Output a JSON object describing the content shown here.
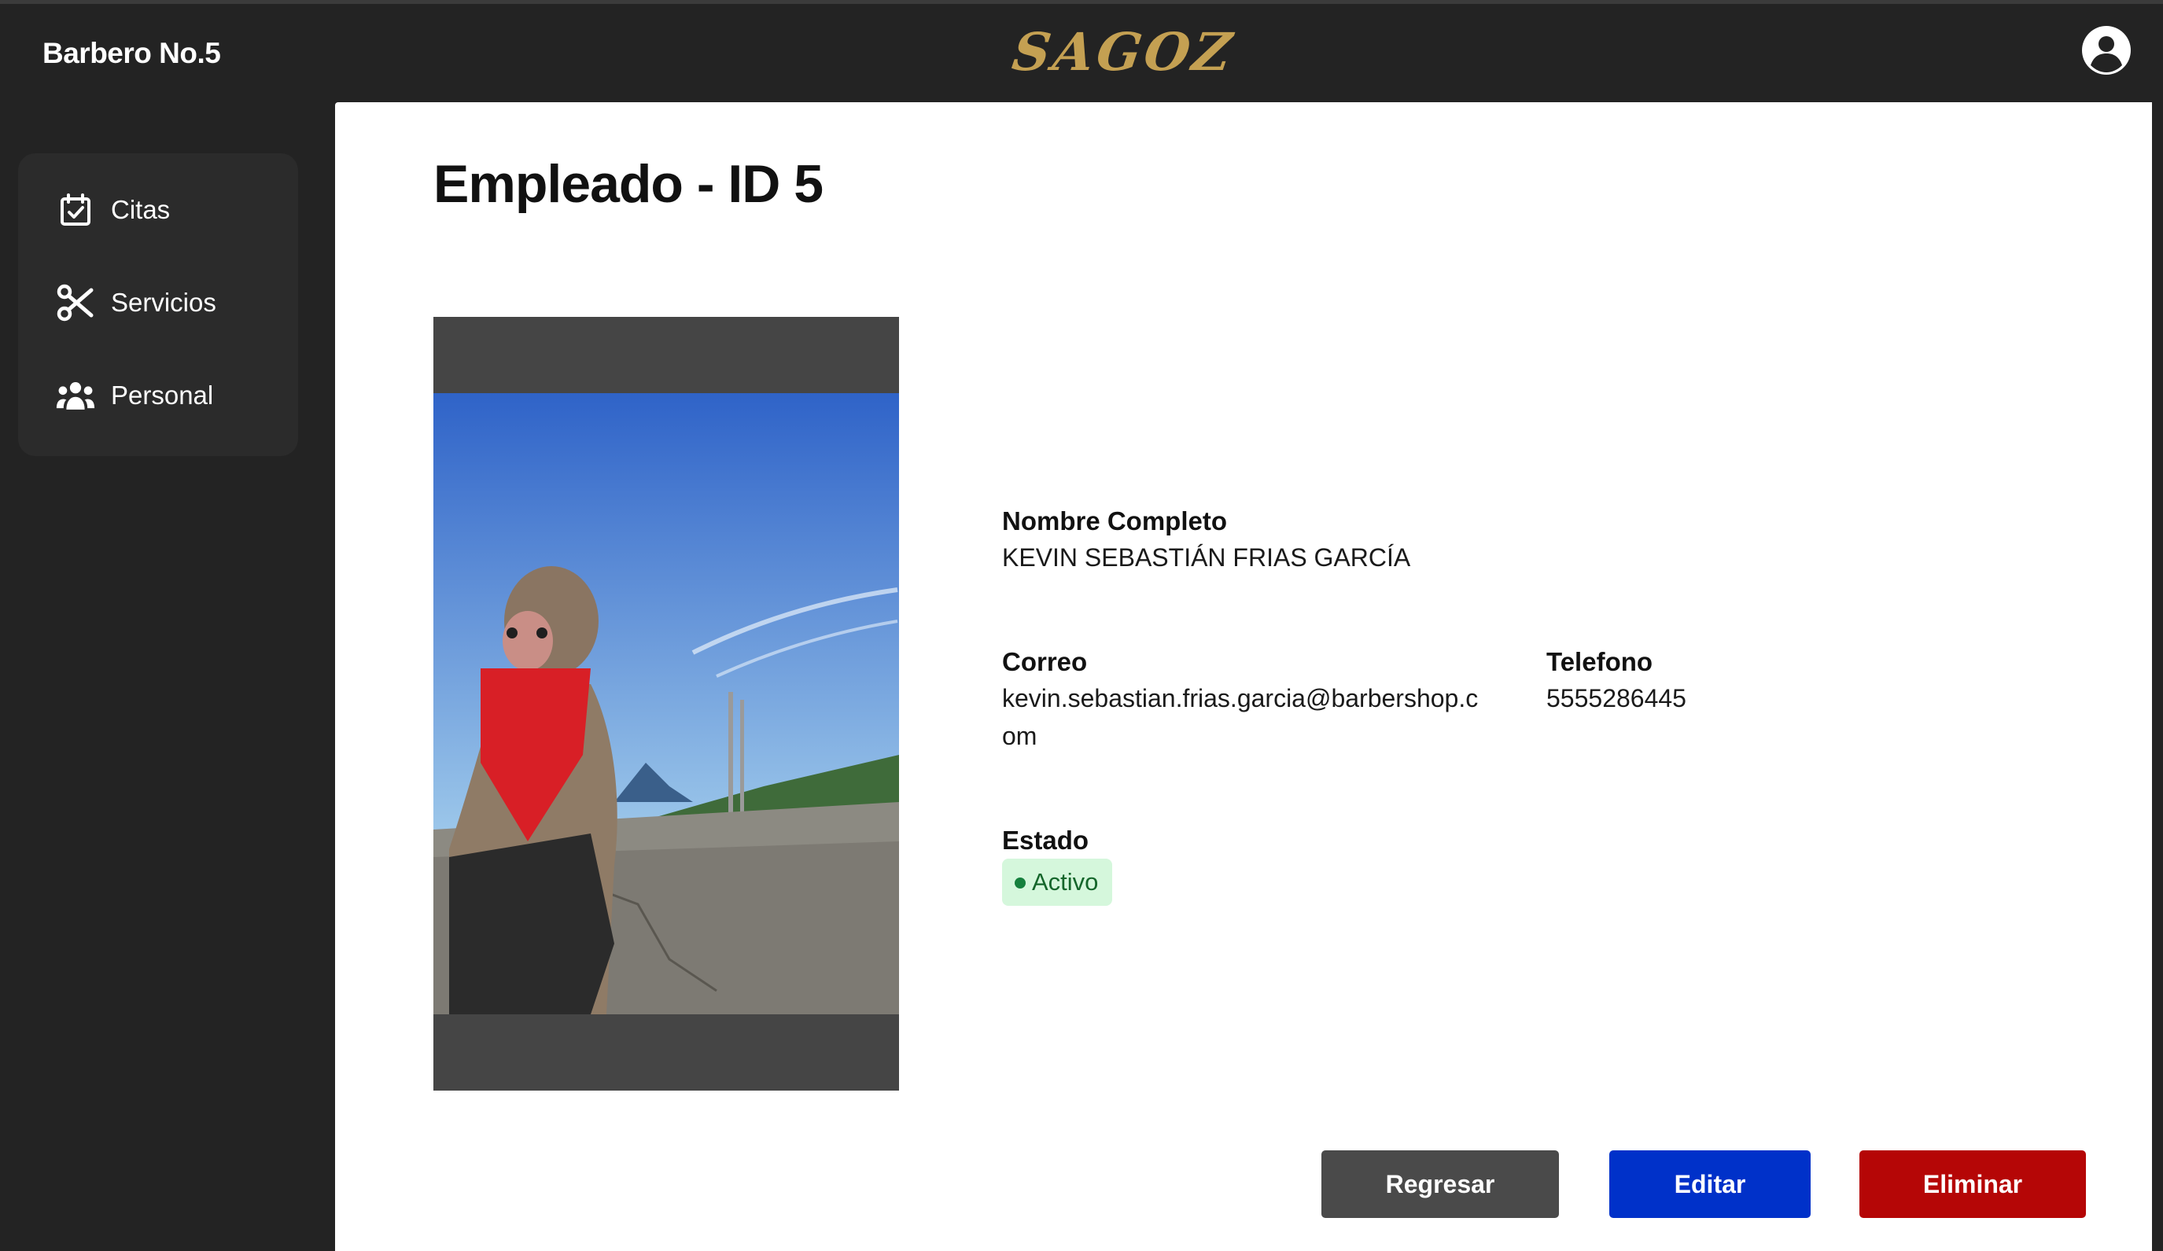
{
  "header": {
    "brand": "Barbero No.5",
    "logo_text": "SAGOZ",
    "logo_color": "#c4a052",
    "account_icon": "user-circle-icon"
  },
  "sidebar": {
    "items": [
      {
        "label": "Citas",
        "icon": "calendar-check-icon"
      },
      {
        "label": "Servicios",
        "icon": "scissors-icon"
      },
      {
        "label": "Personal",
        "icon": "users-icon"
      }
    ]
  },
  "main": {
    "title": "Empleado - ID 5",
    "fields": {
      "nombre_label": "Nombre Completo",
      "nombre_value": "KEVIN SEBASTIÁN FRIAS GARCÍA",
      "correo_label": "Correo",
      "correo_value": "kevin.sebastian.frias.garcia@barbershop.com",
      "telefono_label": "Telefono",
      "telefono_value": "5555286445",
      "estado_label": "Estado",
      "estado_value": "Activo"
    },
    "status_color": "#15803d",
    "buttons": {
      "back": "Regresar",
      "edit": "Editar",
      "delete": "Eliminar"
    },
    "button_colors": {
      "back": "#4a4a4a",
      "edit": "#0031c9",
      "delete": "#b50606"
    }
  }
}
